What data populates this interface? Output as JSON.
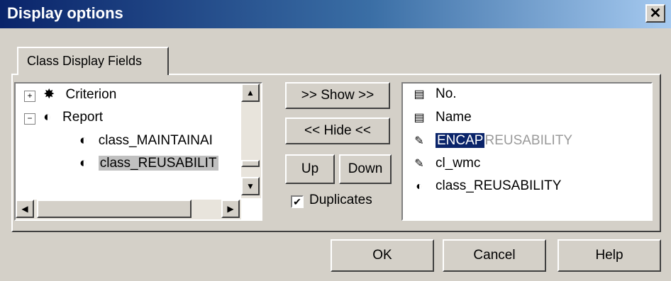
{
  "window": {
    "title": "Display options",
    "close_label": "✕"
  },
  "tab": {
    "label": "Class Display Fields"
  },
  "tree": {
    "items": [
      {
        "label": "Criterion",
        "expander": "+"
      },
      {
        "label": "Report",
        "expander": "−"
      },
      {
        "label": "class_MAINTAINAI"
      },
      {
        "label": "class_REUSABILIT"
      }
    ]
  },
  "buttons": {
    "show": ">> Show >>",
    "hide": "<< Hide <<",
    "up": "Up",
    "down": "Down",
    "ok": "OK",
    "cancel": "Cancel",
    "help": "Help"
  },
  "duplicates": {
    "label": "Duplicates",
    "checked": true
  },
  "fields": [
    {
      "label": "No.",
      "icon": "field-icon"
    },
    {
      "label": "Name",
      "icon": "field-icon"
    },
    {
      "label": "ENCAP",
      "overlay": "REUSABILITY",
      "icon": "drag-icon"
    },
    {
      "label": "cl_wmc",
      "icon": "metric-icon"
    },
    {
      "label": "class_REUSABILITY",
      "icon": "half-circle-icon"
    }
  ]
}
